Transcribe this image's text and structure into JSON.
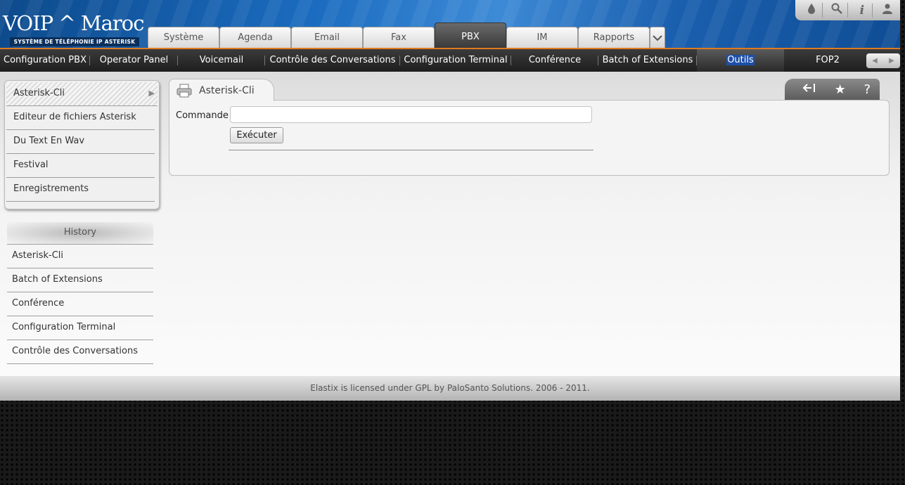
{
  "logo": {
    "brand": "VOIP ^ Maroc",
    "tagline": "SYSTÈME DE TÉLÉPHONIE IP ASTERISK"
  },
  "toolbar_icons": [
    "drop-icon",
    "search-icon",
    "info-icon",
    "user-icon"
  ],
  "top_tabs": [
    {
      "label": "Système"
    },
    {
      "label": "Agenda"
    },
    {
      "label": "Email"
    },
    {
      "label": "Fax"
    },
    {
      "label": "PBX",
      "active": true
    },
    {
      "label": "IM"
    },
    {
      "label": "Rapports"
    }
  ],
  "submenu": [
    {
      "label": "Configuration PBX"
    },
    {
      "label": "Operator Panel"
    },
    {
      "label": "Voicemail"
    },
    {
      "label": "Contrôle des Conversations"
    },
    {
      "label": "Configuration Terminal"
    },
    {
      "label": "Conférence"
    },
    {
      "label": "Batch of Extensions"
    },
    {
      "label": "Outils",
      "active": true
    },
    {
      "label": "FOP2"
    }
  ],
  "side_menu": [
    {
      "label": "Asterisk-Cli",
      "active": true
    },
    {
      "label": "Editeur de fichiers Asterisk"
    },
    {
      "label": "Du Text En Wav"
    },
    {
      "label": "Festival"
    },
    {
      "label": "Enregistrements"
    }
  ],
  "history": {
    "title": "History",
    "items": [
      "Asterisk-Cli",
      "Batch of Extensions",
      "Conférence",
      "Configuration Terminal",
      "Contrôle des Conversations"
    ]
  },
  "panel": {
    "title": "Asterisk-Cli",
    "command_label": "Commande",
    "command_value": "",
    "execute_label": "Exécuter",
    "actions": [
      "collapse-icon",
      "star-icon",
      "help-icon"
    ]
  },
  "footer": {
    "text": "Elastix is licensed under GPL by PaloSanto Solutions. 2006 - 2011."
  },
  "colors": {
    "header_blue": "#1b6cc0",
    "accent_orange": "#e07a1f",
    "submenu_dark": "#2a2a2a",
    "selection_blue": "#1d4fa8"
  }
}
